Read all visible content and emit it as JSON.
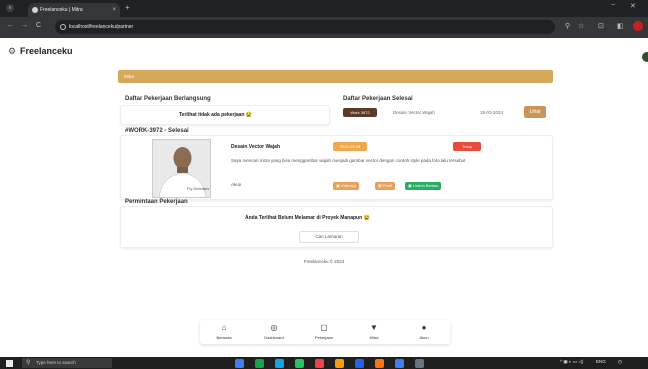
{
  "browser": {
    "tab_title": "Freelanceku | Mitra",
    "tab_close": "×",
    "new_tab": "+",
    "url": "localhost/freelanceku/partner",
    "nav_back": "←",
    "nav_forward": "→",
    "nav_reload": "C",
    "min": "−",
    "close": "✕"
  },
  "app": {
    "brand": "Freelanceku",
    "banner": "Mitra"
  },
  "ongoing": {
    "title": "Daftar Pekerjaan Berlangsung",
    "empty_msg": "Terlihat tidak ada pekerjaan 😭"
  },
  "done": {
    "title": "Daftar Pekerjaan Selesai",
    "job_code": "Work 3972",
    "job_name": "Desain Vector Wajah",
    "date": "15-03-2024",
    "view_label": "Lihat"
  },
  "work": {
    "header": "#WORK-3972 - Selesai",
    "name": "Desain Vector Wajah",
    "date_badge": "2024-03-15",
    "status_badge": "Tutup",
    "description": "Saya mencari mitra yang bisa menggambar wajah menjadi gambar vector dengan contoh style pada foto lalu tersebut",
    "akun_label": "Akun",
    "actions": [
      "Hubungi",
      "Profil",
      "Unduh Berkas"
    ],
    "action_colors": [
      "#e8a05a",
      "#e8a05a",
      "#27ae60"
    ],
    "photo_caption": "Fly Emirates"
  },
  "requests": {
    "title": "Permintaan Pekerjaan",
    "empty_msg": "Anda Terlihat Belum Melamar di Proyek Manapun 😭",
    "search_btn": "Cari Lamaran"
  },
  "footer": "Freelanceku © 2024",
  "bottom_nav": [
    {
      "icon": "⌂",
      "label": "Beranda"
    },
    {
      "icon": "◎",
      "label": "Dashboard"
    },
    {
      "icon": "▢",
      "label": "Pekerjaan"
    },
    {
      "icon": "▼",
      "label": "Mitra"
    },
    {
      "icon": "●",
      "label": "Akun"
    }
  ],
  "taskbar": {
    "search_placeholder": "Type here to search",
    "lang": "ENG"
  },
  "colors": {
    "accent": "#d6a85a",
    "dark_badge": "#5a3b25",
    "status_red": "#e74c3c",
    "date_orange": "#f0a84e"
  }
}
